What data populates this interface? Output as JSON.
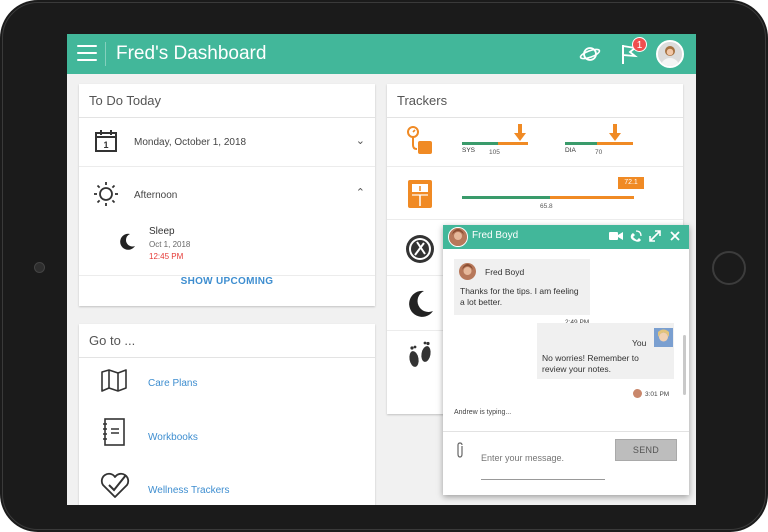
{
  "app": {
    "title": "Fred's Dashboard",
    "accent_color": "#42b79a",
    "link_color": "#3e8ed0",
    "icons": [
      "menu-icon",
      "saturn-icon",
      "flag-icon",
      "avatar"
    ],
    "notification_count": "1"
  },
  "todo": {
    "title": "To Do Today",
    "date_label": "Monday, October 1, 2018",
    "period_label": "Afternoon",
    "task": {
      "name": "Sleep",
      "date": "Oct 1, 2018",
      "time": "12:45 PM",
      "time_color": "#e53935"
    },
    "show_upcoming": "SHOW UPCOMING"
  },
  "goto": {
    "title": "Go to ...",
    "items": [
      {
        "label": "Care Plans",
        "icon": "map-icon"
      },
      {
        "label": "Workbooks",
        "icon": "notebook-icon"
      },
      {
        "label": "Wellness Trackers",
        "icon": "heart-check-icon"
      }
    ]
  },
  "trackers": {
    "title": "Trackers",
    "bp": {
      "sys_label": "SYS",
      "sys_value": "105",
      "dia_label": "DIA",
      "dia_value": "70"
    },
    "weight": {
      "value": "65.8",
      "current": "72.1"
    },
    "other_icons": [
      "fork-knife-icon",
      "moon-icon",
      "footprints-icon"
    ]
  },
  "chat": {
    "contact": "Fred Boyd",
    "incoming": {
      "sender": "Fred Boyd",
      "text_line1": "Thanks for the tips. I am feeling",
      "text_line2": "a lot better.",
      "time": "2:49 PM"
    },
    "outgoing": {
      "sender": "You",
      "text_line1": "No worries! Remember to",
      "text_line2": "review your notes.",
      "time": "3:01 PM"
    },
    "typing": "Andrew is typing...",
    "input_placeholder": "Enter your message.",
    "send_label": "SEND"
  }
}
